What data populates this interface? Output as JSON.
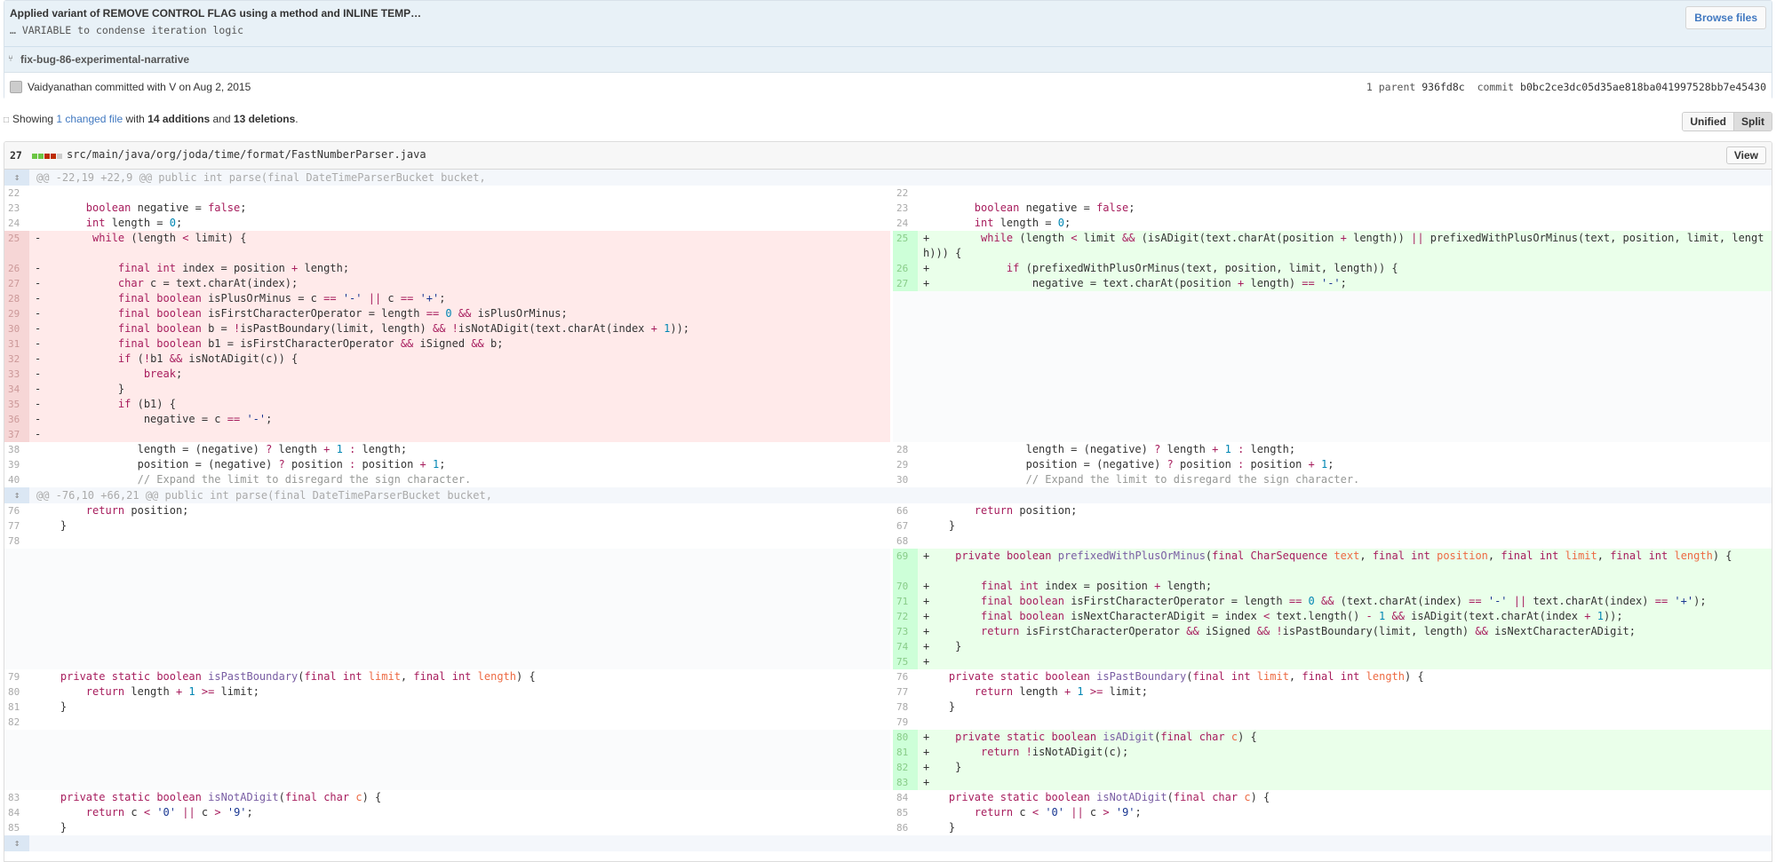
{
  "commit": {
    "title": "Applied variant of REMOVE CONTROL FLAG using a method and INLINE TEMP…",
    "description": "… VARIABLE to condense iteration logic",
    "browse_files": "Browse files",
    "branch": "fix-bug-86-experimental-narrative",
    "author_line": "Vaidyanathan committed with V on Aug 2, 2015",
    "parents_label": "1 parent",
    "parent_sha": "936fd8c",
    "commit_label": "commit",
    "commit_sha": "b0bc2ce3dc05d35ae818ba041997528bb7e45430"
  },
  "toc": {
    "showing": "Showing",
    "changed_files": "1 changed file",
    "with": "with",
    "additions": "14 additions",
    "and": "and",
    "deletions": "13 deletions",
    "end": "."
  },
  "view_toggle": {
    "unified": "Unified",
    "split": "Split"
  },
  "file": {
    "count": "27",
    "path": "src/main/java/org/joda/time/format/FastNumberParser.java",
    "view_button": "View"
  },
  "colors": {
    "addition": "#6cc644",
    "deletion": "#bd2c00",
    "neutral": "#cccccc",
    "link": "#4078c0"
  },
  "icons": {
    "branch": "branch-icon",
    "expand": "expand-icon",
    "toc": "file-diff-icon"
  },
  "diff_rows": [
    {
      "type": "hunk",
      "text": "@@ -22,19 +22,9 @@ public int parse(final DateTimeParserBucket bucket,"
    },
    {
      "l": {
        "n": "22",
        "t": "ctx",
        "c": ""
      },
      "r": {
        "n": "22",
        "t": "ctx",
        "c": ""
      }
    },
    {
      "l": {
        "n": "23",
        "t": "ctx",
        "c": "        <k>boolean</k> negative = <k>false</k>;"
      },
      "r": {
        "n": "23",
        "t": "ctx",
        "c": "        <k>boolean</k> negative = <k>false</k>;"
      }
    },
    {
      "l": {
        "n": "24",
        "t": "ctx",
        "c": "        <k>int</k> length = <n>0</n>;"
      },
      "r": {
        "n": "24",
        "t": "ctx",
        "c": "        <k>int</k> length = <n>0</n>;"
      }
    },
    {
      "tall": true,
      "l": {
        "n": "25",
        "t": "del",
        "c": "-        <k>while</k> (length <k><</k> limit) {"
      },
      "r": {
        "n": "25",
        "t": "add",
        "c": "+        <k>while</k> (length <k><</k> limit <k>&&</k> (isADigit(text.charAt(position <k>+</k> length)) <k>||</k> prefixedWithPlusOrMinus(text, position, limit, length))) {"
      }
    },
    {
      "l": {
        "n": "26",
        "t": "del",
        "c": "-            <k>final</k> <k>int</k> index = position <k>+</k> length;"
      },
      "r": {
        "n": "26",
        "t": "add",
        "c": "+            <k>if</k> (prefixedWithPlusOrMinus(text, position, limit, length)) {"
      }
    },
    {
      "l": {
        "n": "27",
        "t": "del",
        "c": "-            <k>char</k> c = text.charAt(index);"
      },
      "r": {
        "n": "27",
        "t": "add",
        "c": "+                negative = text.charAt(position <k>+</k> length) <k>==</k> <s>'-'</s>;"
      }
    },
    {
      "l": {
        "n": "28",
        "t": "del",
        "c": "-            <k>final</k> <k>boolean</k> isPlusOrMinus = c <k>==</k> <s>'-'</s> <k>||</k> c <k>==</k> <s>'+'</s>;"
      },
      "r": {
        "t": "empty"
      }
    },
    {
      "l": {
        "n": "29",
        "t": "del",
        "c": "-            <k>final</k> <k>boolean</k> isFirstCharacterOperator = length <k>==</k> <n>0</n> <k>&&</k> isPlusOrMinus;"
      },
      "r": {
        "t": "empty"
      }
    },
    {
      "l": {
        "n": "30",
        "t": "del",
        "c": "-            <k>final</k> <k>boolean</k> b = <k>!</k>isPastBoundary(limit, length) <k>&&</k> <k>!</k>isNotADigit(text.charAt(index <k>+</k> <n>1</n>));"
      },
      "r": {
        "t": "empty"
      }
    },
    {
      "l": {
        "n": "31",
        "t": "del",
        "c": "-            <k>final</k> <k>boolean</k> b1 = isFirstCharacterOperator <k>&&</k> iSigned <k>&&</k> b;"
      },
      "r": {
        "t": "empty"
      }
    },
    {
      "l": {
        "n": "32",
        "t": "del",
        "c": "-            <k>if</k> (<k>!</k>b1 <k>&&</k> isNotADigit(c)) {"
      },
      "r": {
        "t": "empty"
      }
    },
    {
      "l": {
        "n": "33",
        "t": "del",
        "c": "-                <k>break</k>;"
      },
      "r": {
        "t": "empty"
      }
    },
    {
      "l": {
        "n": "34",
        "t": "del",
        "c": "-            }"
      },
      "r": {
        "t": "empty"
      }
    },
    {
      "l": {
        "n": "35",
        "t": "del",
        "c": "-            <k>if</k> (b1) {"
      },
      "r": {
        "t": "empty"
      }
    },
    {
      "l": {
        "n": "36",
        "t": "del",
        "c": "-                negative = c <k>==</k> <s>'-'</s>;"
      },
      "r": {
        "t": "empty"
      }
    },
    {
      "l": {
        "n": "37",
        "t": "del",
        "c": "-"
      },
      "r": {
        "t": "empty"
      }
    },
    {
      "l": {
        "n": "38",
        "t": "ctx",
        "c": "                length = (negative) <k>?</k> length <k>+</k> <n>1</n> <k>:</k> length;"
      },
      "r": {
        "n": "28",
        "t": "ctx",
        "c": "                length = (negative) <k>?</k> length <k>+</k> <n>1</n> <k>:</k> length;"
      }
    },
    {
      "l": {
        "n": "39",
        "t": "ctx",
        "c": "                position = (negative) <k>?</k> position <k>:</k> position <k>+</k> <n>1</n>;"
      },
      "r": {
        "n": "29",
        "t": "ctx",
        "c": "                position = (negative) <k>?</k> position <k>:</k> position <k>+</k> <n>1</n>;"
      }
    },
    {
      "l": {
        "n": "40",
        "t": "ctx",
        "c": "                <m>// Expand the limit to disregard the sign character.</m>"
      },
      "r": {
        "n": "30",
        "t": "ctx",
        "c": "                <m>// Expand the limit to disregard the sign character.</m>"
      }
    },
    {
      "type": "hunk",
      "text": "@@ -76,10 +66,21 @@ public int parse(final DateTimeParserBucket bucket,"
    },
    {
      "l": {
        "n": "76",
        "t": "ctx",
        "c": "        <k>return</k> position;"
      },
      "r": {
        "n": "66",
        "t": "ctx",
        "c": "        <k>return</k> position;"
      }
    },
    {
      "l": {
        "n": "77",
        "t": "ctx",
        "c": "    }"
      },
      "r": {
        "n": "67",
        "t": "ctx",
        "c": "    }"
      }
    },
    {
      "l": {
        "n": "78",
        "t": "ctx",
        "c": ""
      },
      "r": {
        "n": "68",
        "t": "ctx",
        "c": ""
      }
    },
    {
      "tall": true,
      "l": {
        "t": "empty"
      },
      "r": {
        "n": "69",
        "t": "add",
        "c": "+    <k>private</k> <k>boolean</k> <f>prefixedWithPlusOrMinus</f>(<k>final</k> <k>CharSequence</k> <p>text</p>, <k>final</k> <k>int</k> <p>position</p>, <k>final</k> <k>int</k> <p>limit</p>, <k>final</k> <k>int</k> <p>length</p>) {"
      }
    },
    {
      "l": {
        "t": "empty"
      },
      "r": {
        "n": "70",
        "t": "add",
        "c": "+        <k>final</k> <k>int</k> index = position <k>+</k> length;"
      }
    },
    {
      "l": {
        "t": "empty"
      },
      "r": {
        "n": "71",
        "t": "add",
        "c": "+        <k>final</k> <k>boolean</k> isFirstCharacterOperator = length <k>==</k> <n>0</n> <k>&&</k> (text.charAt(index) <k>==</k> <s>'-'</s> <k>||</k> text.charAt(index) <k>==</k> <s>'+'</s>);"
      }
    },
    {
      "l": {
        "t": "empty"
      },
      "r": {
        "n": "72",
        "t": "add",
        "c": "+        <k>final</k> <k>boolean</k> isNextCharacterADigit = index <k><</k> text.length() <k>-</k> <n>1</n> <k>&&</k> isADigit(text.charAt(index <k>+</k> <n>1</n>));"
      }
    },
    {
      "l": {
        "t": "empty"
      },
      "r": {
        "n": "73",
        "t": "add",
        "c": "+        <k>return</k> isFirstCharacterOperator <k>&&</k> iSigned <k>&&</k> <k>!</k>isPastBoundary(limit, length) <k>&&</k> isNextCharacterADigit;"
      }
    },
    {
      "l": {
        "t": "empty"
      },
      "r": {
        "n": "74",
        "t": "add",
        "c": "+    }"
      }
    },
    {
      "l": {
        "t": "empty"
      },
      "r": {
        "n": "75",
        "t": "add",
        "c": "+"
      }
    },
    {
      "l": {
        "n": "79",
        "t": "ctx",
        "c": "    <k>private</k> <k>static</k> <k>boolean</k> <f>isPastBoundary</f>(<k>final</k> <k>int</k> <p>limit</p>, <k>final</k> <k>int</k> <p>length</p>) {"
      },
      "r": {
        "n": "76",
        "t": "ctx",
        "c": "    <k>private</k> <k>static</k> <k>boolean</k> <f>isPastBoundary</f>(<k>final</k> <k>int</k> <p>limit</p>, <k>final</k> <k>int</k> <p>length</p>) {"
      }
    },
    {
      "l": {
        "n": "80",
        "t": "ctx",
        "c": "        <k>return</k> length <k>+</k> <n>1</n> <k>>=</k> limit;"
      },
      "r": {
        "n": "77",
        "t": "ctx",
        "c": "        <k>return</k> length <k>+</k> <n>1</n> <k>>=</k> limit;"
      }
    },
    {
      "l": {
        "n": "81",
        "t": "ctx",
        "c": "    }"
      },
      "r": {
        "n": "78",
        "t": "ctx",
        "c": "    }"
      }
    },
    {
      "l": {
        "n": "82",
        "t": "ctx",
        "c": ""
      },
      "r": {
        "n": "79",
        "t": "ctx",
        "c": ""
      }
    },
    {
      "l": {
        "t": "empty"
      },
      "r": {
        "n": "80",
        "t": "add",
        "c": "+    <k>private</k> <k>static</k> <k>boolean</k> <f>isADigit</f>(<k>final</k> <k>char</k> <p>c</p>) {"
      }
    },
    {
      "l": {
        "t": "empty"
      },
      "r": {
        "n": "81",
        "t": "add",
        "c": "+        <k>return</k> <k>!</k>isNotADigit(c);"
      }
    },
    {
      "l": {
        "t": "empty"
      },
      "r": {
        "n": "82",
        "t": "add",
        "c": "+    }"
      }
    },
    {
      "l": {
        "t": "empty"
      },
      "r": {
        "n": "83",
        "t": "add",
        "c": "+"
      }
    },
    {
      "l": {
        "n": "83",
        "t": "ctx",
        "c": "    <k>private</k> <k>static</k> <k>boolean</k> <f>isNotADigit</f>(<k>final</k> <k>char</k> <p>c</p>) {"
      },
      "r": {
        "n": "84",
        "t": "ctx",
        "c": "    <k>private</k> <k>static</k> <k>boolean</k> <f>isNotADigit</f>(<k>final</k> <k>char</k> <p>c</p>) {"
      }
    },
    {
      "l": {
        "n": "84",
        "t": "ctx",
        "c": "        <k>return</k> c <k><</k> <s>'0'</s> <k>||</k> c <k>></k> <s>'9'</s>;"
      },
      "r": {
        "n": "85",
        "t": "ctx",
        "c": "        <k>return</k> c <k><</k> <s>'0'</s> <k>||</k> c <k>></k> <s>'9'</s>;"
      }
    },
    {
      "l": {
        "n": "85",
        "t": "ctx",
        "c": "    }"
      },
      "r": {
        "n": "86",
        "t": "ctx",
        "c": "    }"
      }
    },
    {
      "type": "hunk",
      "text": ""
    }
  ]
}
